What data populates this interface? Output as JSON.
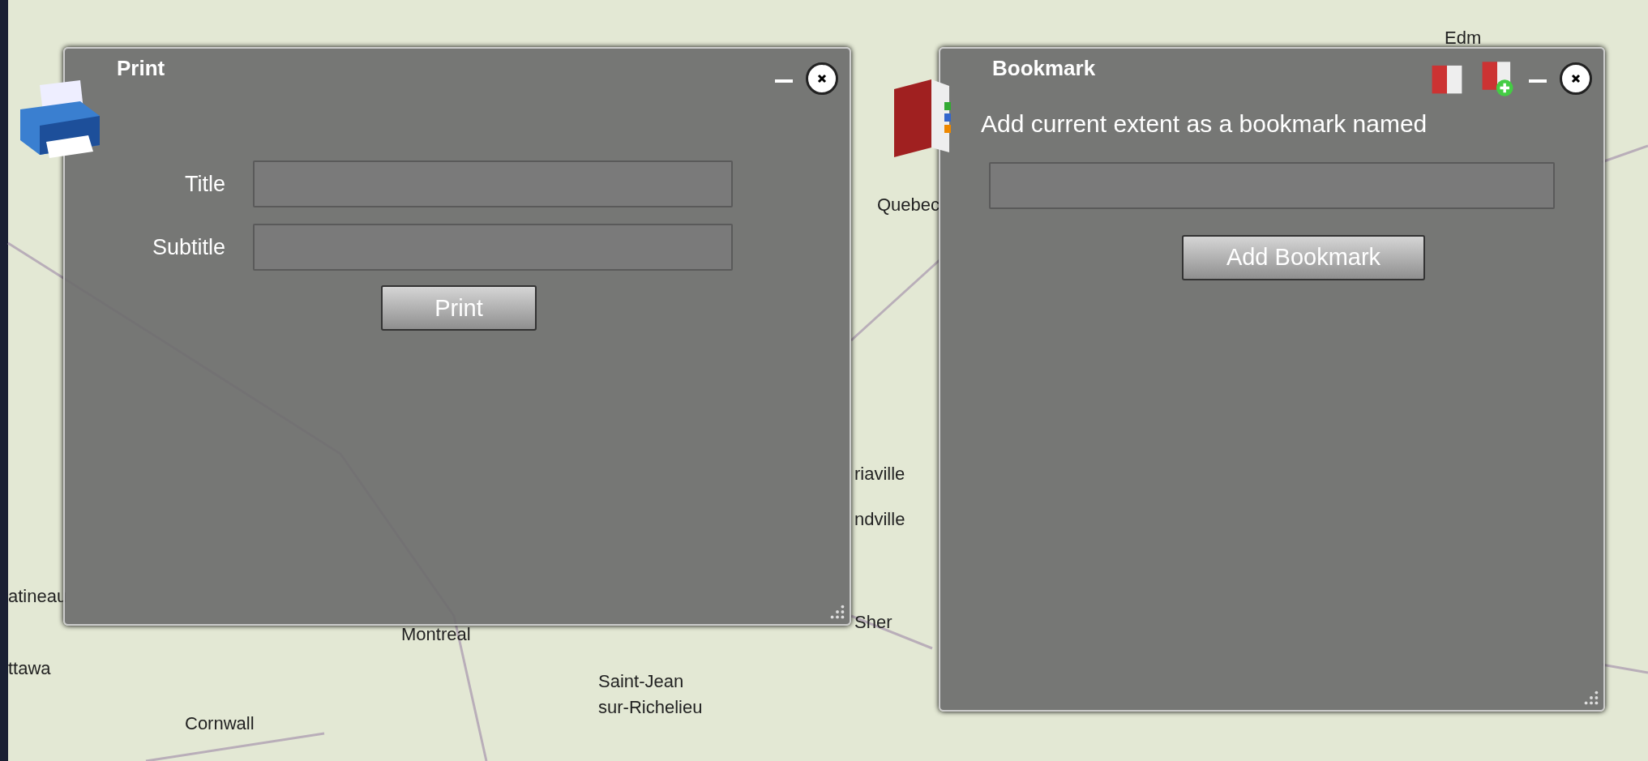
{
  "map": {
    "labels": [
      {
        "text": "Edm"
      },
      {
        "text": "Quebec"
      },
      {
        "text": "riaville"
      },
      {
        "text": "ndville"
      },
      {
        "text": "Sher"
      },
      {
        "text": "atineau"
      },
      {
        "text": "ttawa"
      },
      {
        "text": "Montreal"
      },
      {
        "text": "Saint-Jean"
      },
      {
        "text": "sur-Richelieu"
      },
      {
        "text": "Cornwall"
      }
    ]
  },
  "print_panel": {
    "title": "Print",
    "fields": [
      {
        "label": "Title"
      },
      {
        "label": "Subtitle"
      }
    ],
    "button": "Print"
  },
  "bookmark_panel": {
    "title": "Bookmark",
    "prompt": "Add current extent as a bookmark named",
    "button": "Add Bookmark"
  }
}
